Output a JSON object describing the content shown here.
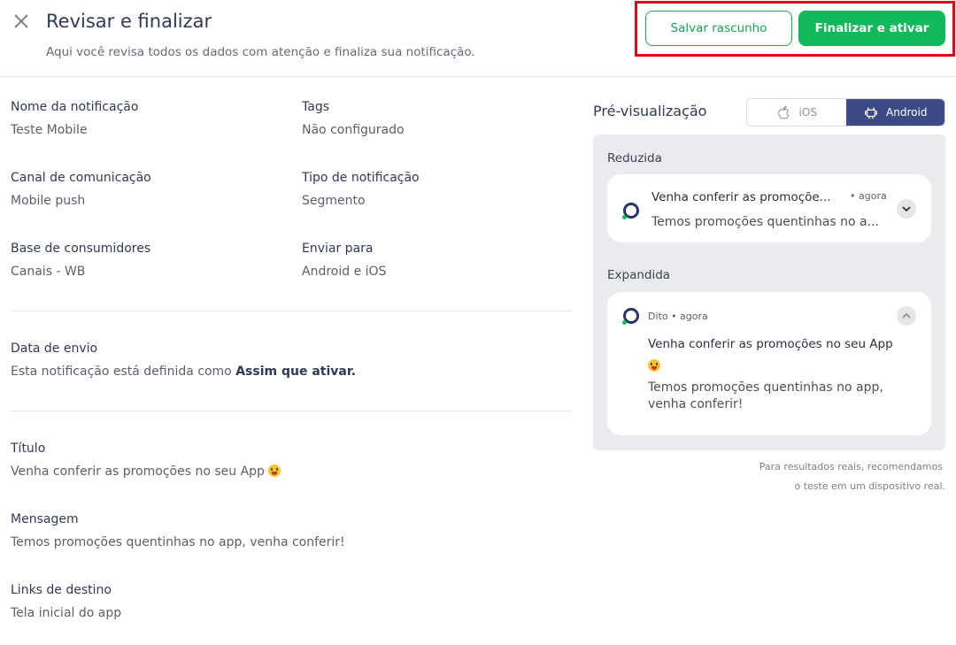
{
  "header": {
    "title": "Revisar e finalizar",
    "subtitle": "Aqui você revisa todos os dados com atenção e finaliza sua notificação.",
    "draft_label": "Salvar rascunho",
    "finalize_label": "Finalizar e ativar"
  },
  "fields": {
    "name_label": "Nome da notificação",
    "name_value": "Teste Mobile",
    "tags_label": "Tags",
    "tags_value": "Não configurado",
    "channel_label": "Canal de comunicação",
    "channel_value": "Mobile push",
    "type_label": "Tipo de notificação",
    "type_value": "Segmento",
    "base_label": "Base de consumidores",
    "base_value": "Canais - WB",
    "send_to_label": "Enviar para",
    "send_to_value": "Android e iOS",
    "date_label": "Data de envio",
    "date_prefix": "Esta notificação está definida como",
    "date_bold": "Assim que ativar.",
    "title_label": "Título",
    "title_value": "Venha conferir as promoções no seu App",
    "message_label": "Mensagem",
    "message_value": "Temos promoções quentinhas no app, venha conferir!",
    "links_label": "Links de destino",
    "links_value": "Tela inicial do app"
  },
  "preview": {
    "title": "Pré-visualização",
    "ios_label": "iOS",
    "android_label": "Android",
    "selected": "Android",
    "reduced_label": "Reduzida",
    "reduced_title": "Venha conferir as promoçõe...",
    "reduced_time": "• agora",
    "reduced_text": "Temos promoções quentinhas no a...",
    "expanded_label": "Expandida",
    "expanded_meta": "Dito • agora",
    "expanded_title": "Venha conferir as promoções no seu App",
    "expanded_text_1": "Temos promoções quentinhas no app,",
    "expanded_text_2": "venha conferir!",
    "footnote_1": "Para resultados reais, recomendamos",
    "footnote_2": "o teste em um dispositivo real."
  },
  "colors": {
    "primary_green": "#10b95a",
    "android_active": "#3d4a86",
    "highlight_red": "#e0061a"
  },
  "icons": [
    "close-icon",
    "apple-icon",
    "android-icon",
    "chevron-down-icon",
    "chevron-up-icon",
    "app-logo-icon",
    "grinning-emoji-icon"
  ]
}
